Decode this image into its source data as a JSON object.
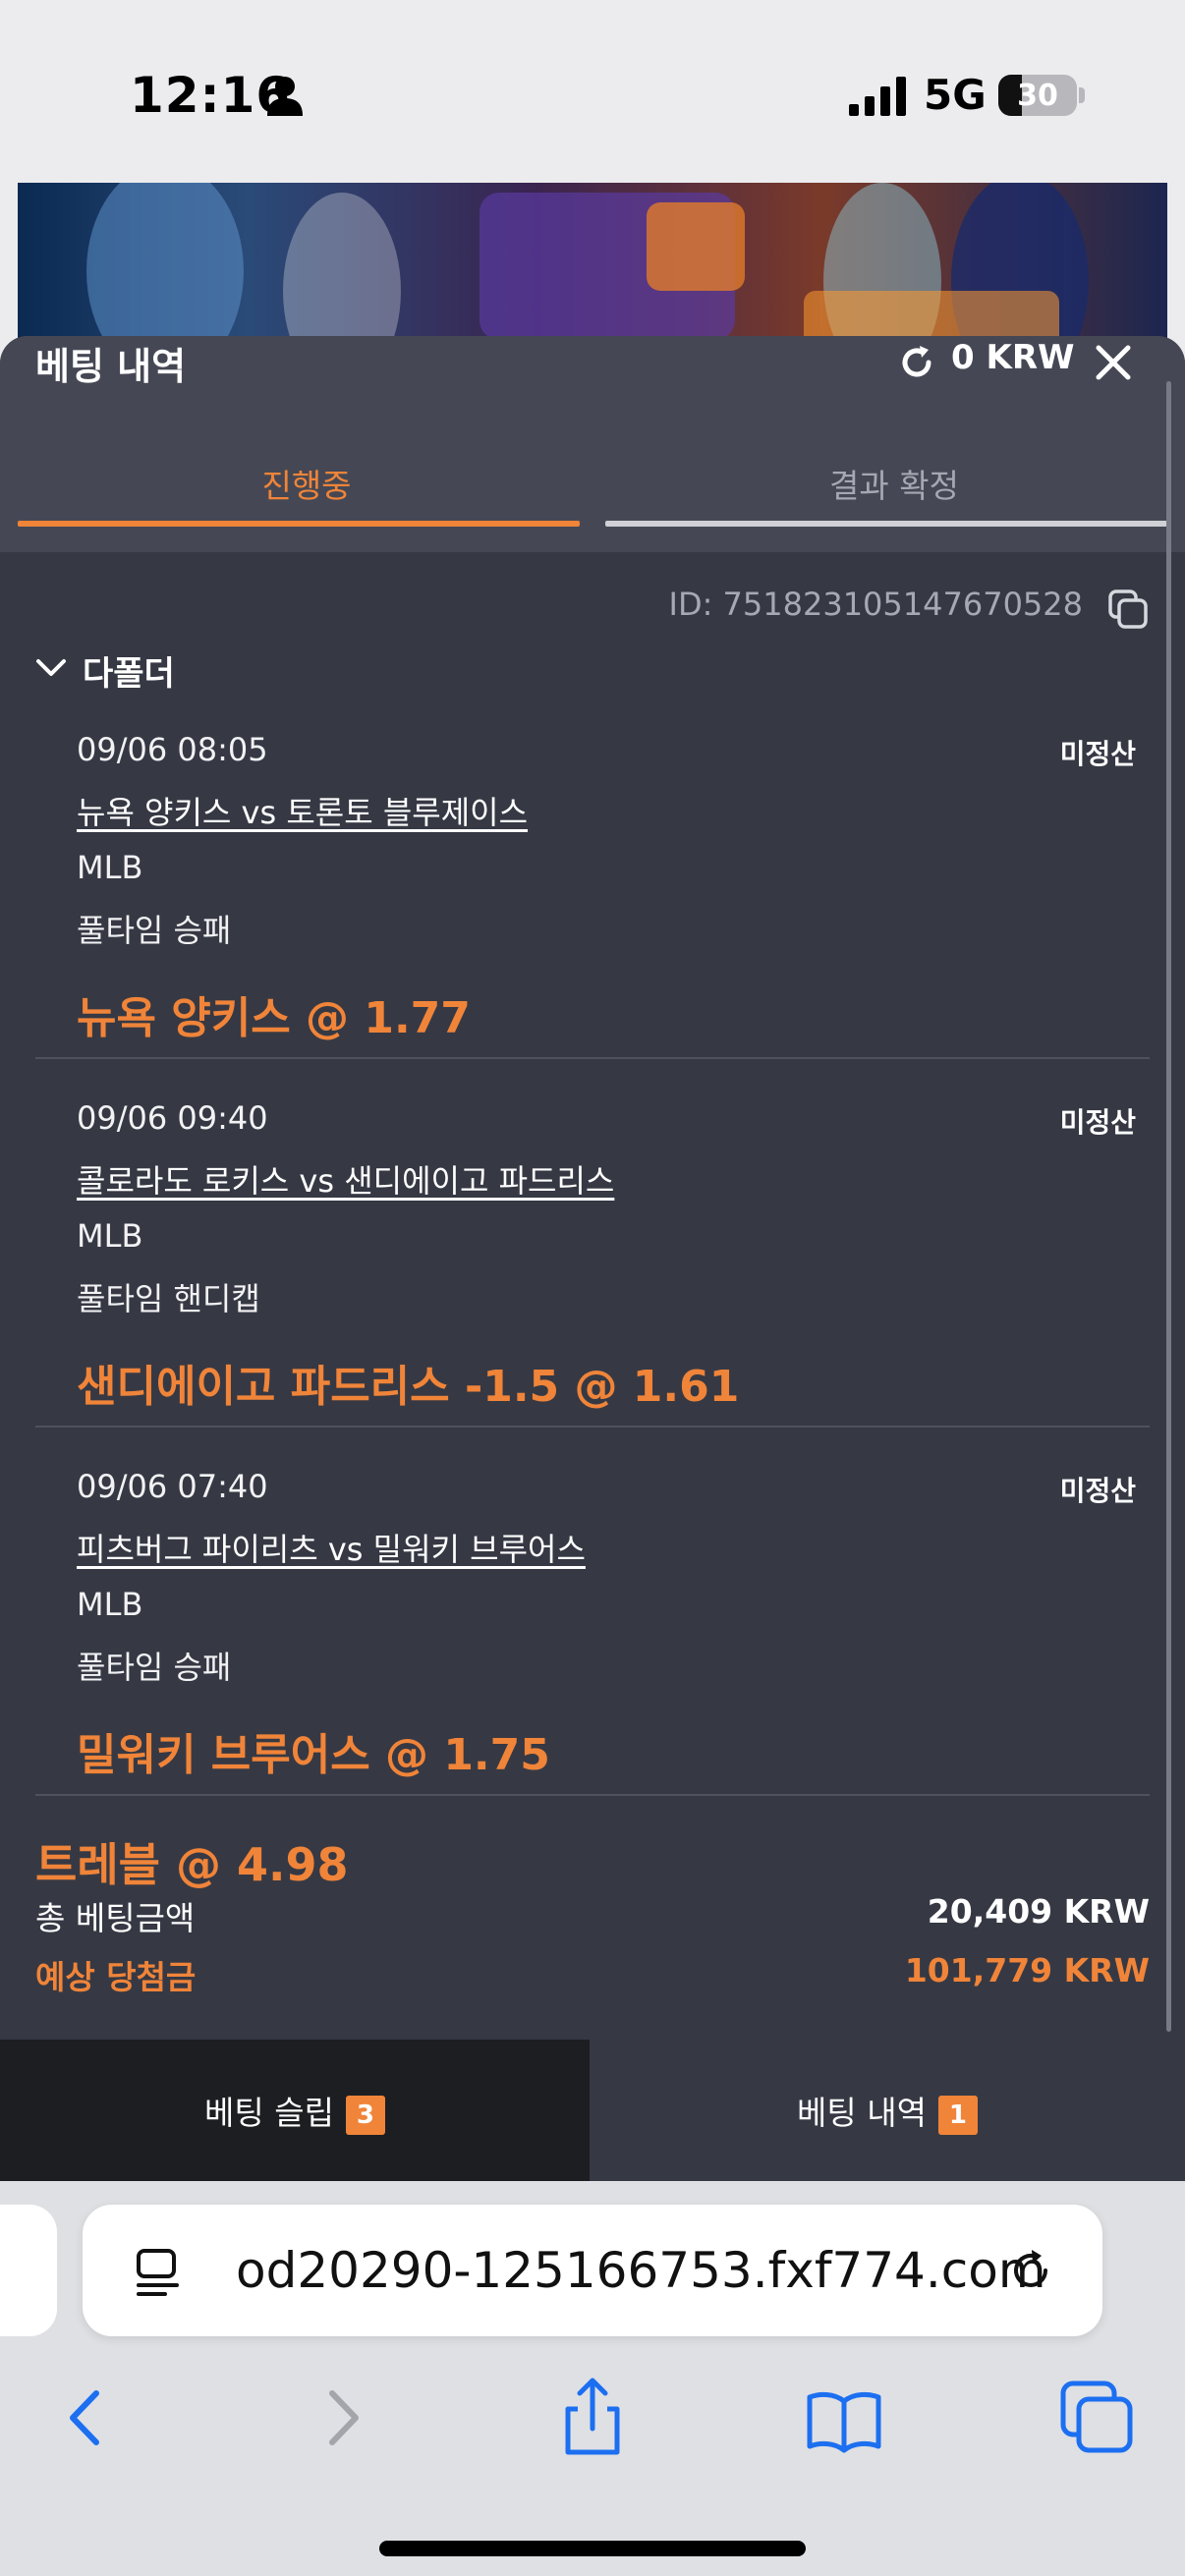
{
  "status_bar": {
    "time": "12:16",
    "network": "5G",
    "battery_level": "30",
    "battery_fraction": 0.3,
    "icons": [
      "person-icon",
      "signal-icon",
      "battery-icon"
    ]
  },
  "sheet": {
    "title": "베팅 내역",
    "balance": "0 KRW",
    "tabs": [
      {
        "label": "진행중",
        "active": true
      },
      {
        "label": "결과 확정",
        "active": false
      }
    ],
    "bet_id": "ID: 751823105147670528",
    "group_label": "다폴더",
    "bets": [
      {
        "datetime": "09/06 08:05",
        "status": "미정산",
        "match": "뉴욕 양키스 vs 토론토 블루제이스",
        "league": "MLB",
        "market": "풀타임 승패",
        "pick": "뉴욕 양키스 @ 1.77"
      },
      {
        "datetime": "09/06 09:40",
        "status": "미정산",
        "match": "콜로라도 로키스 vs 샌디에이고 파드리스",
        "league": "MLB",
        "market": "풀타임 핸디캡",
        "pick": "샌디에이고 파드리스 -1.5 @ 1.61"
      },
      {
        "datetime": "09/06 07:40",
        "status": "미정산",
        "match": "피츠버그 파이리츠 vs 밀워키 브루어스",
        "league": "MLB",
        "market": "풀타임 승패",
        "pick": "밀워키 브루어스 @ 1.75"
      }
    ],
    "summary": {
      "type_odds": "트레블 @ 4.98",
      "total_label": "총 베팅금액",
      "total_value": "20,409 KRW",
      "expected_label": "예상 당첨금",
      "expected_value": "101,779 KRW"
    },
    "footer": {
      "slip_label": "베팅 슬립",
      "slip_count": "3",
      "history_label": "베팅 내역",
      "history_count": "1"
    }
  },
  "browser": {
    "url": "od20290-125166753.fxf774.com",
    "nav_icons": [
      "back-icon",
      "forward-icon",
      "share-icon",
      "bookmarks-icon",
      "tabs-icon"
    ]
  },
  "colors": {
    "accent": "#f08439",
    "sheet_bg": "#363944",
    "header_bg": "#454854",
    "footer_active_bg": "#1d1e22"
  }
}
